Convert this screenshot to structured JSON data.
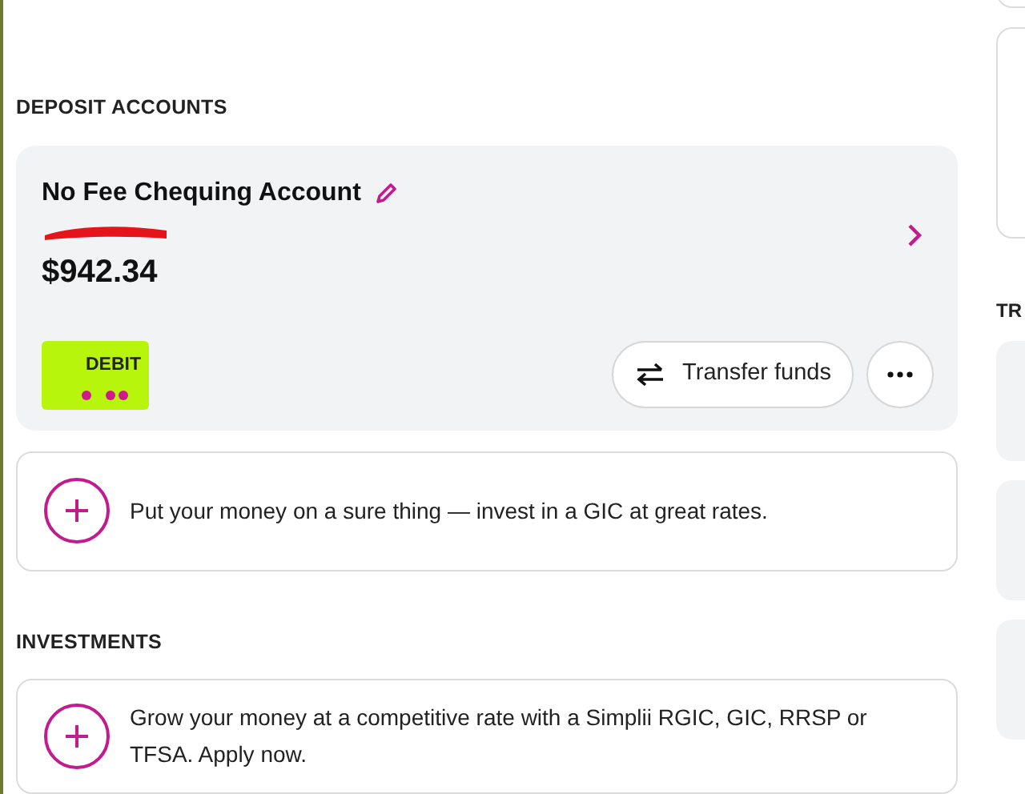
{
  "sections": [
    {
      "title": "DEPOSIT ACCOUNTS",
      "accounts": [
        {
          "name": "No Fee Chequing Account",
          "balance": "$942.34",
          "card_label": "DEBIT",
          "redacted": true,
          "actions": [
            "Transfer funds"
          ]
        }
      ],
      "promo": "Put your money on a sure thing — invest in a GIC at great rates."
    },
    {
      "title": "INVESTMENTS",
      "promo": "Grow your money at a competitive rate with a Simplii RGIC, GIC, RRSP or TFSA. Apply now."
    }
  ],
  "side": {
    "heading": "TR"
  }
}
